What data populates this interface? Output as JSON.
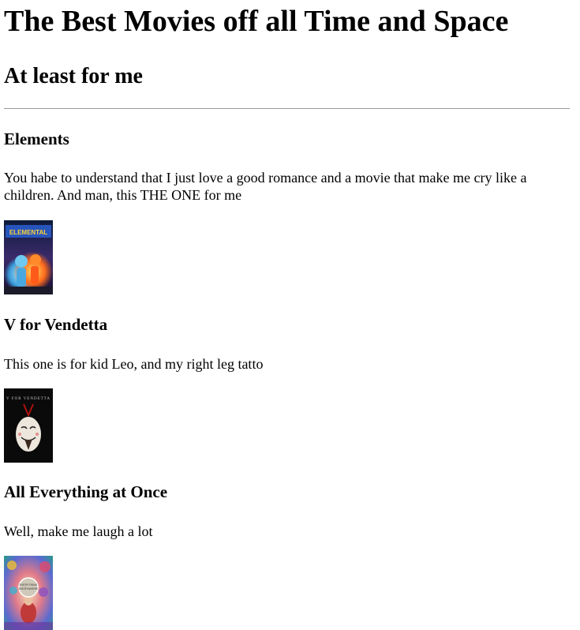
{
  "page": {
    "title": "The Best Movies off all Time and Space",
    "subtitle": "At least for me"
  },
  "movies": [
    {
      "title": "Elements",
      "description": "You habe to understand that I just love a good romance and a movie that make me cry like a children. And man, this THE ONE for me",
      "poster_alt": "Elemental poster",
      "poster_text": "ELEMENTAL"
    },
    {
      "title": "V for Vendetta",
      "description": "This one is for kid Leo, and my right leg tatto",
      "poster_alt": "V for Vendetta poster",
      "poster_text": "V FOR VENDETTA"
    },
    {
      "title": "All Everything at Once",
      "description": "Well, make me laugh a lot",
      "poster_alt": "Everything Everywhere All at Once poster"
    }
  ]
}
